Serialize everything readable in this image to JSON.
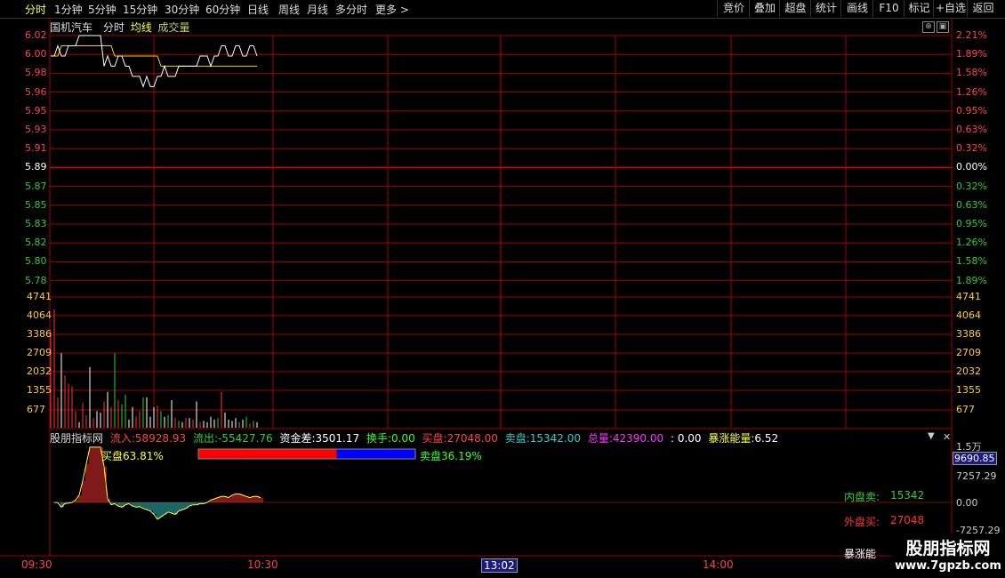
{
  "tabs": {
    "periods": [
      "分时",
      "1分钟",
      "5分钟",
      "15分钟",
      "30分钟",
      "60分钟",
      "日线",
      "周线",
      "月线",
      "多分时",
      "更多 >"
    ],
    "active": "分时",
    "buttons": [
      "竞价",
      "叠加",
      "超盘",
      "统计",
      "画线",
      "F10",
      "标记",
      "+自选",
      "返回"
    ]
  },
  "chart_header": {
    "stock": "国机汽车",
    "mode": "分时",
    "avg": "均线",
    "volume": "成交量"
  },
  "price_axis": {
    "left": [
      "6.02",
      "6.00",
      "5.98",
      "5.96",
      "5.95",
      "5.93",
      "5.91",
      "5.89",
      "5.87",
      "5.85",
      "5.83",
      "5.82",
      "5.80",
      "5.78"
    ],
    "right": [
      "2.21%",
      "1.89%",
      "1.58%",
      "1.26%",
      "0.95%",
      "0.63%",
      "0.32%",
      "0.00%",
      "0.32%",
      "0.63%",
      "0.95%",
      "1.26%",
      "1.58%",
      "1.89%"
    ],
    "prev_close": "5.89"
  },
  "volume_axis": [
    "4741",
    "4064",
    "3386",
    "2709",
    "2032",
    "1355",
    "677"
  ],
  "indicator": {
    "name": "股朋指标网",
    "inflow_label": "流入:",
    "inflow": "58928.93",
    "outflow_label": "流出:",
    "outflow": "-55427.76",
    "diff_label": "资金差:",
    "diff": "3501.17",
    "turnover_label": "换手:",
    "turnover": "0.00",
    "buy_label": "买盘:",
    "buy": "27048.00",
    "sell_label": "卖盘:",
    "sell": "15342.00",
    "total_label": "总量:",
    "total": "42390.00",
    "extra": ": 0.00",
    "surge_label": "暴涨能量:",
    "surge": "6.52",
    "buy_pct": "买盘63.81%",
    "sell_pct": "卖盘36.19%",
    "inner_label": "内盘卖:",
    "inner_val": "15342",
    "outer_label": "外盘买:",
    "outer_val": "27048",
    "surge_short": "暴涨能",
    "axis": [
      "1.5万",
      "9690.85",
      "7257.29",
      "0.00",
      "-7257.29"
    ]
  },
  "time_axis": [
    "09:30",
    "10:30",
    "13:02",
    "14:00"
  ],
  "watermark": {
    "title": "股朋指标网",
    "url": "www.7gpzb.com"
  },
  "colors": {
    "up": "#ff3333",
    "down": "#33cc33",
    "grid": "#a00000",
    "price": "#ffffff",
    "avg": "#ffcc00"
  },
  "chart_data": {
    "type": "line",
    "title": "",
    "price_series": [
      6.0,
      6.0,
      6.01,
      6.0,
      6.0,
      6.01,
      6.01,
      6.01,
      6.02,
      6.02,
      6.02,
      6.02,
      6.02,
      6.02,
      6.02,
      5.99,
      6.0,
      5.99,
      5.99,
      6.0,
      6.0,
      5.99,
      5.99,
      5.98,
      5.98,
      5.98,
      5.97,
      5.98,
      5.97,
      5.97,
      5.98,
      5.98,
      5.99,
      5.98,
      5.98,
      5.98,
      5.99,
      5.99,
      5.99,
      5.99,
      5.99,
      5.99,
      6.0,
      6.0,
      6.0,
      5.99,
      6.0,
      6.0,
      6.01,
      6.01,
      6.0,
      6.0,
      6.01,
      6.01,
      6.0,
      6.0,
      6.01,
      6.01,
      6.0
    ],
    "avg_series": [
      6.0,
      6.0,
      6.0,
      6.01,
      6.01,
      6.01,
      6.01,
      6.01,
      6.01,
      6.01,
      6.01,
      6.01,
      6.01,
      6.01,
      6.01,
      6.01,
      6.01,
      6.01,
      6.0,
      6.0,
      6.0,
      6.0,
      6.0,
      6.0,
      6.0,
      6.0,
      6.0,
      6.0,
      6.0,
      6.0,
      6.0,
      5.99,
      5.99,
      5.99,
      5.99,
      5.99,
      5.99,
      5.99,
      5.99,
      5.99,
      5.99,
      5.99,
      5.99,
      5.99,
      5.99,
      5.99,
      5.99,
      5.99,
      5.99,
      5.99,
      5.99,
      5.99,
      5.99,
      5.99,
      5.99,
      5.99,
      5.99,
      5.99,
      5.99
    ],
    "ylim": [
      5.76,
      6.02
    ],
    "volumes": [
      3500,
      4300,
      1100,
      2700,
      1900,
      1600,
      1500,
      600,
      200,
      900,
      450,
      2200,
      350,
      600,
      550,
      950,
      1300,
      750,
      2700,
      1000,
      850,
      1200,
      300,
      750,
      400,
      600,
      1100,
      1100,
      400,
      750,
      800,
      600,
      400,
      450,
      1000,
      350,
      250,
      200,
      350,
      350,
      300,
      950,
      200,
      250,
      200,
      400,
      300,
      350,
      1300,
      550,
      300,
      250,
      350,
      200,
      300,
      400,
      150,
      250,
      200
    ],
    "volume_colors": "rrrwrrrrwrrwrwwrwrgrggwwrrgwwwrgwgwrgwrwrwrwwwwgrwwwwgwgrgw",
    "flow_series": [
      0,
      -2,
      -40,
      -10,
      -5,
      0,
      20,
      60,
      180,
      320,
      460,
      460,
      460,
      460,
      300,
      30,
      -20,
      -10,
      -30,
      -40,
      -20,
      -10,
      -30,
      -40,
      -35,
      -50,
      -60,
      -70,
      -100,
      -140,
      -120,
      -100,
      -80,
      -90,
      -100,
      -70,
      -60,
      -50,
      -30,
      -20,
      -20,
      -10,
      -10,
      0,
      20,
      30,
      40,
      50,
      50,
      40,
      60,
      70,
      70,
      60,
      50,
      40,
      50,
      50,
      40
    ],
    "flow_ylim": [
      -80,
      16
    ],
    "buy_ratio": 0.6381,
    "sell_ratio": 0.3619
  }
}
